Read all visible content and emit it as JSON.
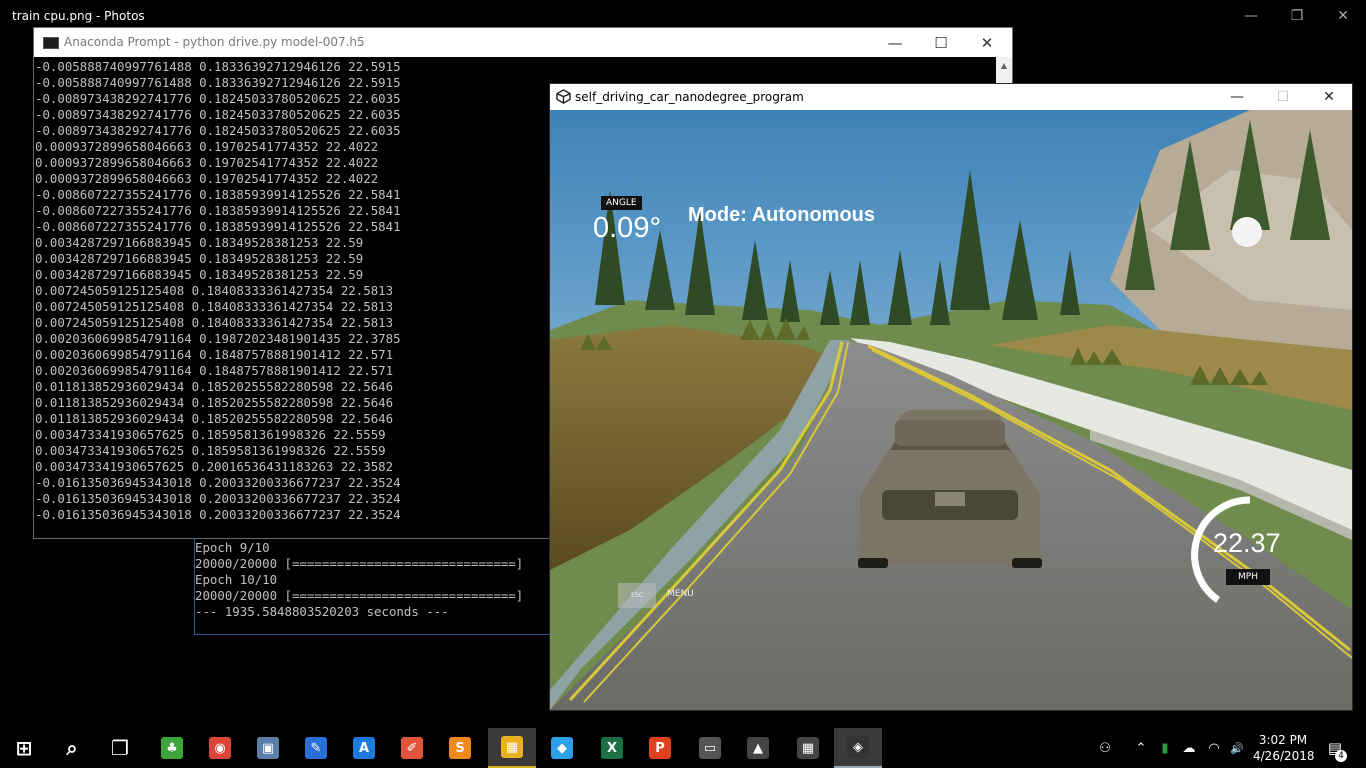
{
  "photos": {
    "title": "train cpu.png - Photos",
    "minimize": "—",
    "maximize": "❐",
    "close": "✕"
  },
  "anaconda": {
    "title": "Anaconda Prompt - python  drive.py model-007.h5",
    "minimize": "—",
    "maximize": "☐",
    "close": "✕",
    "scroll_up": "▲",
    "lines": [
      "-0.005888740997761488 0.18336392712946126 22.5915",
      "-0.005888740997761488 0.18336392712946126 22.5915",
      "-0.008973438292741776 0.18245033780520625 22.6035",
      "-0.008973438292741776 0.18245033780520625 22.6035",
      "-0.008973438292741776 0.18245033780520625 22.6035",
      "0.0009372899658046663 0.19702541774352 22.4022",
      "0.0009372899658046663 0.19702541774352 22.4022",
      "0.0009372899658046663 0.19702541774352 22.4022",
      "-0.008607227355241776 0.18385939914125526 22.5841",
      "-0.008607227355241776 0.18385939914125526 22.5841",
      "-0.008607227355241776 0.18385939914125526 22.5841",
      "0.0034287297166883945 0.18349528381253 22.59",
      "0.0034287297166883945 0.18349528381253 22.59",
      "0.0034287297166883945 0.18349528381253 22.59",
      "0.007245059125125408 0.18408333361427354 22.5813",
      "0.007245059125125408 0.18408333361427354 22.5813",
      "0.007245059125125408 0.18408333361427354 22.5813",
      "0.0020360699854791164 0.19872023481901435 22.3785",
      "0.0020360699854791164 0.18487578881901412 22.571",
      "0.0020360699854791164 0.18487578881901412 22.571",
      "0.011813852936029434 0.18520255582280598 22.5646",
      "0.011813852936029434 0.18520255582280598 22.5646",
      "0.011813852936029434 0.18520255582280598 22.5646",
      "0.003473341930657625 0.1859581361998326 22.5559",
      "0.003473341930657625 0.1859581361998326 22.5559",
      "0.003473341930657625 0.20016536431183263 22.3582",
      "-0.016135036945343018 0.20033200336677237 22.3524",
      "-0.016135036945343018 0.20033200336677237 22.3524",
      "-0.016135036945343018 0.20033200336677237 22.3524"
    ]
  },
  "training_log": {
    "lines": [
      "Epoch 9/10",
      "20000/20000 [==============================]",
      "Epoch 10/10",
      "20000/20000 [==============================]",
      "--- 1935.5848803520203 seconds ---"
    ]
  },
  "unity": {
    "title": "self_driving_car_nanodegree_program",
    "minimize": "—",
    "maximize": "☐",
    "close": "✕",
    "hud": {
      "angle_label": "ANGLE",
      "angle_value": "0.09°",
      "mode": "Mode: Autonomous",
      "esc_label": "ESC",
      "menu_label": "MENU",
      "speed_value": "22.37",
      "speed_unit": "MPH",
      "speed_fraction": 0.45
    }
  },
  "taskbar": {
    "apps": [
      {
        "name": "start-button",
        "glyph": "⊞",
        "color": "#000000"
      },
      {
        "name": "search-icon",
        "glyph": "⌕",
        "color": "#000000"
      },
      {
        "name": "task-view-icon",
        "glyph": "❐",
        "color": "#000000"
      },
      {
        "name": "clover-app-icon",
        "glyph": "♣",
        "color": "#3fa53a"
      },
      {
        "name": "chrome-icon",
        "glyph": "◉",
        "color": "#db4437"
      },
      {
        "name": "system-info-icon",
        "glyph": "▣",
        "color": "#5a7fa8"
      },
      {
        "name": "paint-icon",
        "glyph": "✎",
        "color": "#2a6fd6"
      },
      {
        "name": "app-store-icon",
        "glyph": "A",
        "color": "#1f7ae0"
      },
      {
        "name": "pen-app-icon",
        "glyph": "✐",
        "color": "#e0553a"
      },
      {
        "name": "sublime-text-icon",
        "glyph": "S",
        "color": "#ef8a1a"
      },
      {
        "name": "matlab-icon",
        "glyph": "▦",
        "color": "#e8b21e"
      },
      {
        "name": "elephant-app-icon",
        "glyph": "◆",
        "color": "#2ea0e8"
      },
      {
        "name": "excel-icon",
        "glyph": "X",
        "color": "#1e7145"
      },
      {
        "name": "pdf-icon",
        "glyph": "P",
        "color": "#e0401f"
      },
      {
        "name": "terminal-icon",
        "glyph": "▭",
        "color": "#555555"
      },
      {
        "name": "photos-icon",
        "glyph": "▲",
        "color": "#444444"
      },
      {
        "name": "calculator-icon",
        "glyph": "▦",
        "color": "#444444"
      },
      {
        "name": "unity-icon",
        "glyph": "◈",
        "color": "#333333"
      }
    ],
    "tray": {
      "people": "⚇",
      "chevron": "⌃",
      "battery": "▮",
      "cloud": "☁",
      "wifi": "◠",
      "volume": "🔊",
      "time": "3:02 PM",
      "date": "4/26/2018",
      "notifications": "▤",
      "notification_count": "4"
    }
  }
}
